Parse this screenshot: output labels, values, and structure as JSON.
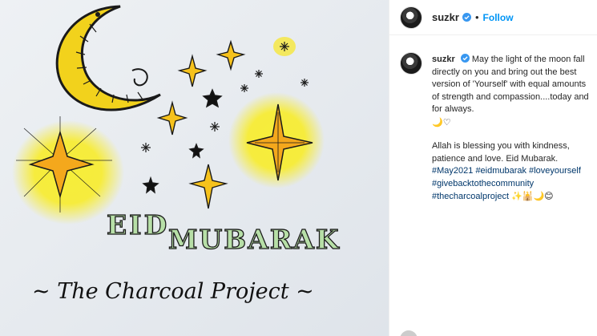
{
  "post": {
    "username": "suzkr",
    "follow_label": "Follow",
    "separator": "•"
  },
  "artwork": {
    "greeting_line1": "EID",
    "greeting_line2": "MUBARAK",
    "signature": "~ The Charcoal Project ~"
  },
  "caption": {
    "username": "suzkr",
    "text_1": "May the light of the moon fall directly on you and bring out the best version of 'Yourself' with equal amounts of strength and compassion....today and for always.",
    "emojis_1": "🌙♡",
    "text_2": "Allah is blessing you with kindness, patience and love. Eid Mubarak.",
    "hashtags": [
      "#May2021",
      "#eidmubarak",
      "#loveyourself",
      "#givebacktothecommunity",
      "#thecharcoalproject"
    ],
    "emojis_2": "✨🕌🌙😊"
  },
  "colors": {
    "accent": "#0095f6",
    "hashtag": "#00376b",
    "star_yellow": "#f6e21a"
  }
}
